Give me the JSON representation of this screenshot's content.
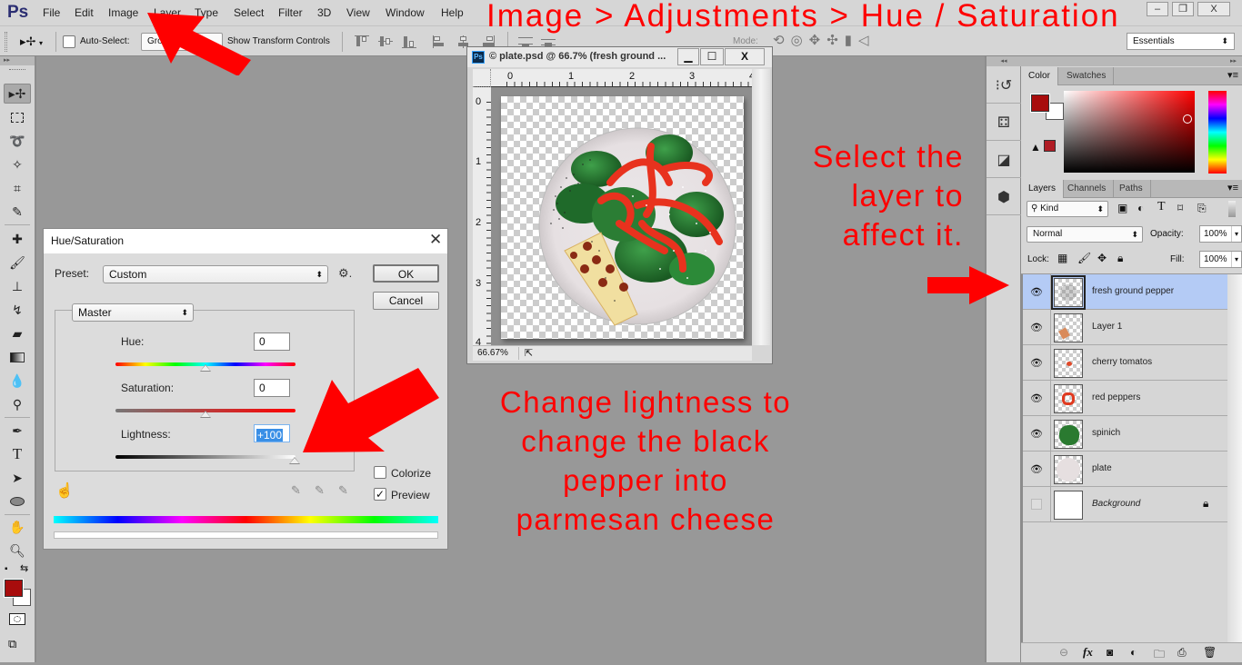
{
  "app": {
    "logo": "Ps",
    "menu": [
      "File",
      "Edit",
      "Image",
      "Layer",
      "Type",
      "Select",
      "Filter",
      "3D",
      "View",
      "Window",
      "Help"
    ],
    "window_controls": {
      "minimize": "–",
      "restore": "❐",
      "close": "X"
    }
  },
  "options_bar": {
    "auto_select_label": "Auto-Select:",
    "auto_select_checked": false,
    "auto_select_target": "Group",
    "show_transform_label": "Show Transform Controls",
    "mode_label": "Mode:",
    "workspace": "Essentials"
  },
  "tools": [
    "move",
    "marquee",
    "lasso",
    "magic-wand",
    "crop",
    "eyedropper",
    "healing-brush",
    "brush",
    "clone-stamp",
    "history-brush",
    "eraser",
    "gradient",
    "blur",
    "dodge",
    "pen",
    "type",
    "path-selection",
    "ellipse",
    "hand",
    "zoom"
  ],
  "colors": {
    "foreground": "#a80c0c",
    "background": "#ffffff",
    "annotation": "#ff0000",
    "selected_layer": "#b4cbf5"
  },
  "document": {
    "icon": "Ps",
    "title": "© plate.psd @ 66.7% (fresh ground ...",
    "ruler_top": [
      "0",
      "1",
      "2",
      "3",
      "4"
    ],
    "ruler_left": [
      "0",
      "1",
      "2",
      "3",
      "4"
    ],
    "zoom": "66.67%"
  },
  "hue_saturation": {
    "title": "Hue/Saturation",
    "preset_label": "Preset:",
    "preset_value": "Custom",
    "ok": "OK",
    "cancel": "Cancel",
    "channel": "Master",
    "hue_label": "Hue:",
    "hue_value": "0",
    "saturation_label": "Saturation:",
    "saturation_value": "0",
    "lightness_label": "Lightness:",
    "lightness_value": "+100",
    "colorize_label": "Colorize",
    "colorize_checked": false,
    "preview_label": "Preview",
    "preview_checked": true
  },
  "annotations": {
    "top": "Image > Adjustments > Hue / Saturation",
    "middle": [
      "Change lightness to",
      "change the black",
      "pepper into",
      "parmesan cheese"
    ],
    "right": [
      "Select the",
      "layer to",
      "affect it."
    ]
  },
  "color_panel": {
    "tabs": [
      "Color",
      "Swatches"
    ],
    "active_tab": "Color"
  },
  "layers_panel": {
    "tabs": [
      "Layers",
      "Channels",
      "Paths"
    ],
    "active_tab": "Layers",
    "filter": "Kind",
    "blend_mode": "Normal",
    "opacity_label": "Opacity:",
    "opacity": "100%",
    "lock_label": "Lock:",
    "fill_label": "Fill:",
    "fill": "100%",
    "layers": [
      {
        "name": "fresh ground pepper",
        "visible": true,
        "selected": true,
        "locked": false
      },
      {
        "name": "Layer 1",
        "visible": true,
        "selected": false,
        "locked": false
      },
      {
        "name": "cherry tomatos",
        "visible": true,
        "selected": false,
        "locked": false
      },
      {
        "name": "red peppers",
        "visible": true,
        "selected": false,
        "locked": false
      },
      {
        "name": "spinich",
        "visible": true,
        "selected": false,
        "locked": false
      },
      {
        "name": "plate",
        "visible": true,
        "selected": false,
        "locked": false
      },
      {
        "name": "Background",
        "visible": false,
        "selected": false,
        "locked": true
      }
    ]
  }
}
